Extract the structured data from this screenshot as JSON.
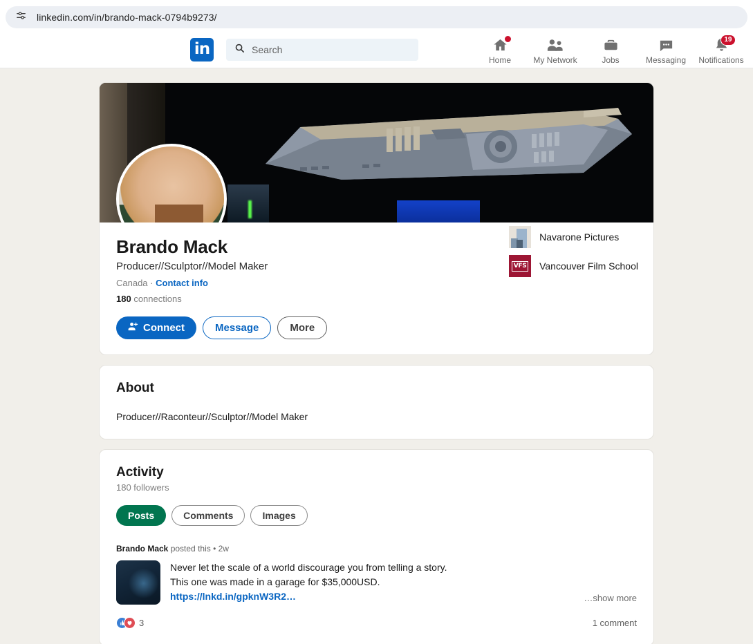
{
  "browser": {
    "url": "linkedin.com/in/brando-mack-0794b9273/",
    "site_settings_icon": "sliders-icon"
  },
  "nav": {
    "logo_text": "in",
    "search_placeholder": "Search",
    "items": [
      {
        "label": "Home",
        "icon": "home-icon",
        "badge": ""
      },
      {
        "label": "My Network",
        "icon": "people-icon",
        "badge": ""
      },
      {
        "label": "Jobs",
        "icon": "briefcase-icon",
        "badge": ""
      },
      {
        "label": "Messaging",
        "icon": "message-bubble-icon",
        "badge": ""
      },
      {
        "label": "Notifications",
        "icon": "bell-icon",
        "badge": "19"
      }
    ]
  },
  "profile": {
    "name": "Brando Mack",
    "headline": "Producer//Sculptor//Model Maker",
    "location": "Canada",
    "separator": "·",
    "contact_info_label": "Contact info",
    "connections_count": "180",
    "connections_label": "connections",
    "actions": [
      {
        "label": "Connect",
        "style": "primary",
        "icon": "person-plus-icon"
      },
      {
        "label": "Message",
        "style": "outline-blue",
        "icon": ""
      },
      {
        "label": "More",
        "style": "outline-gray",
        "icon": ""
      }
    ],
    "organizations": [
      {
        "name": "Navarone Pictures",
        "logo": "navarone-logo"
      },
      {
        "name": "Vancouver Film School",
        "logo": "vfs-logo",
        "logo_text": "VFS"
      }
    ]
  },
  "about": {
    "title": "About",
    "body": "Producer//Raconteur//Sculptor//Model Maker"
  },
  "activity": {
    "title": "Activity",
    "followers": "180 followers",
    "filters": [
      {
        "label": "Posts",
        "active": true
      },
      {
        "label": "Comments",
        "active": false
      },
      {
        "label": "Images",
        "active": false
      }
    ],
    "post": {
      "author": "Brando Mack",
      "meta_suffix": "posted this • 2w",
      "line1": "Never let the scale of a world discourage you from telling a story.",
      "line2": "This one was made in a garage for $35,000USD.",
      "link": "https://lnkd.in/gpknW3R2…",
      "show_more": "…show more",
      "reaction_count": "3",
      "comment_count": "1 comment"
    }
  },
  "colors": {
    "linkedin_blue": "#0a66c2",
    "badge_red": "#cb112d",
    "active_pill_green": "#01754f",
    "page_bg": "#f1efea",
    "vfs_red": "#9d1634"
  }
}
